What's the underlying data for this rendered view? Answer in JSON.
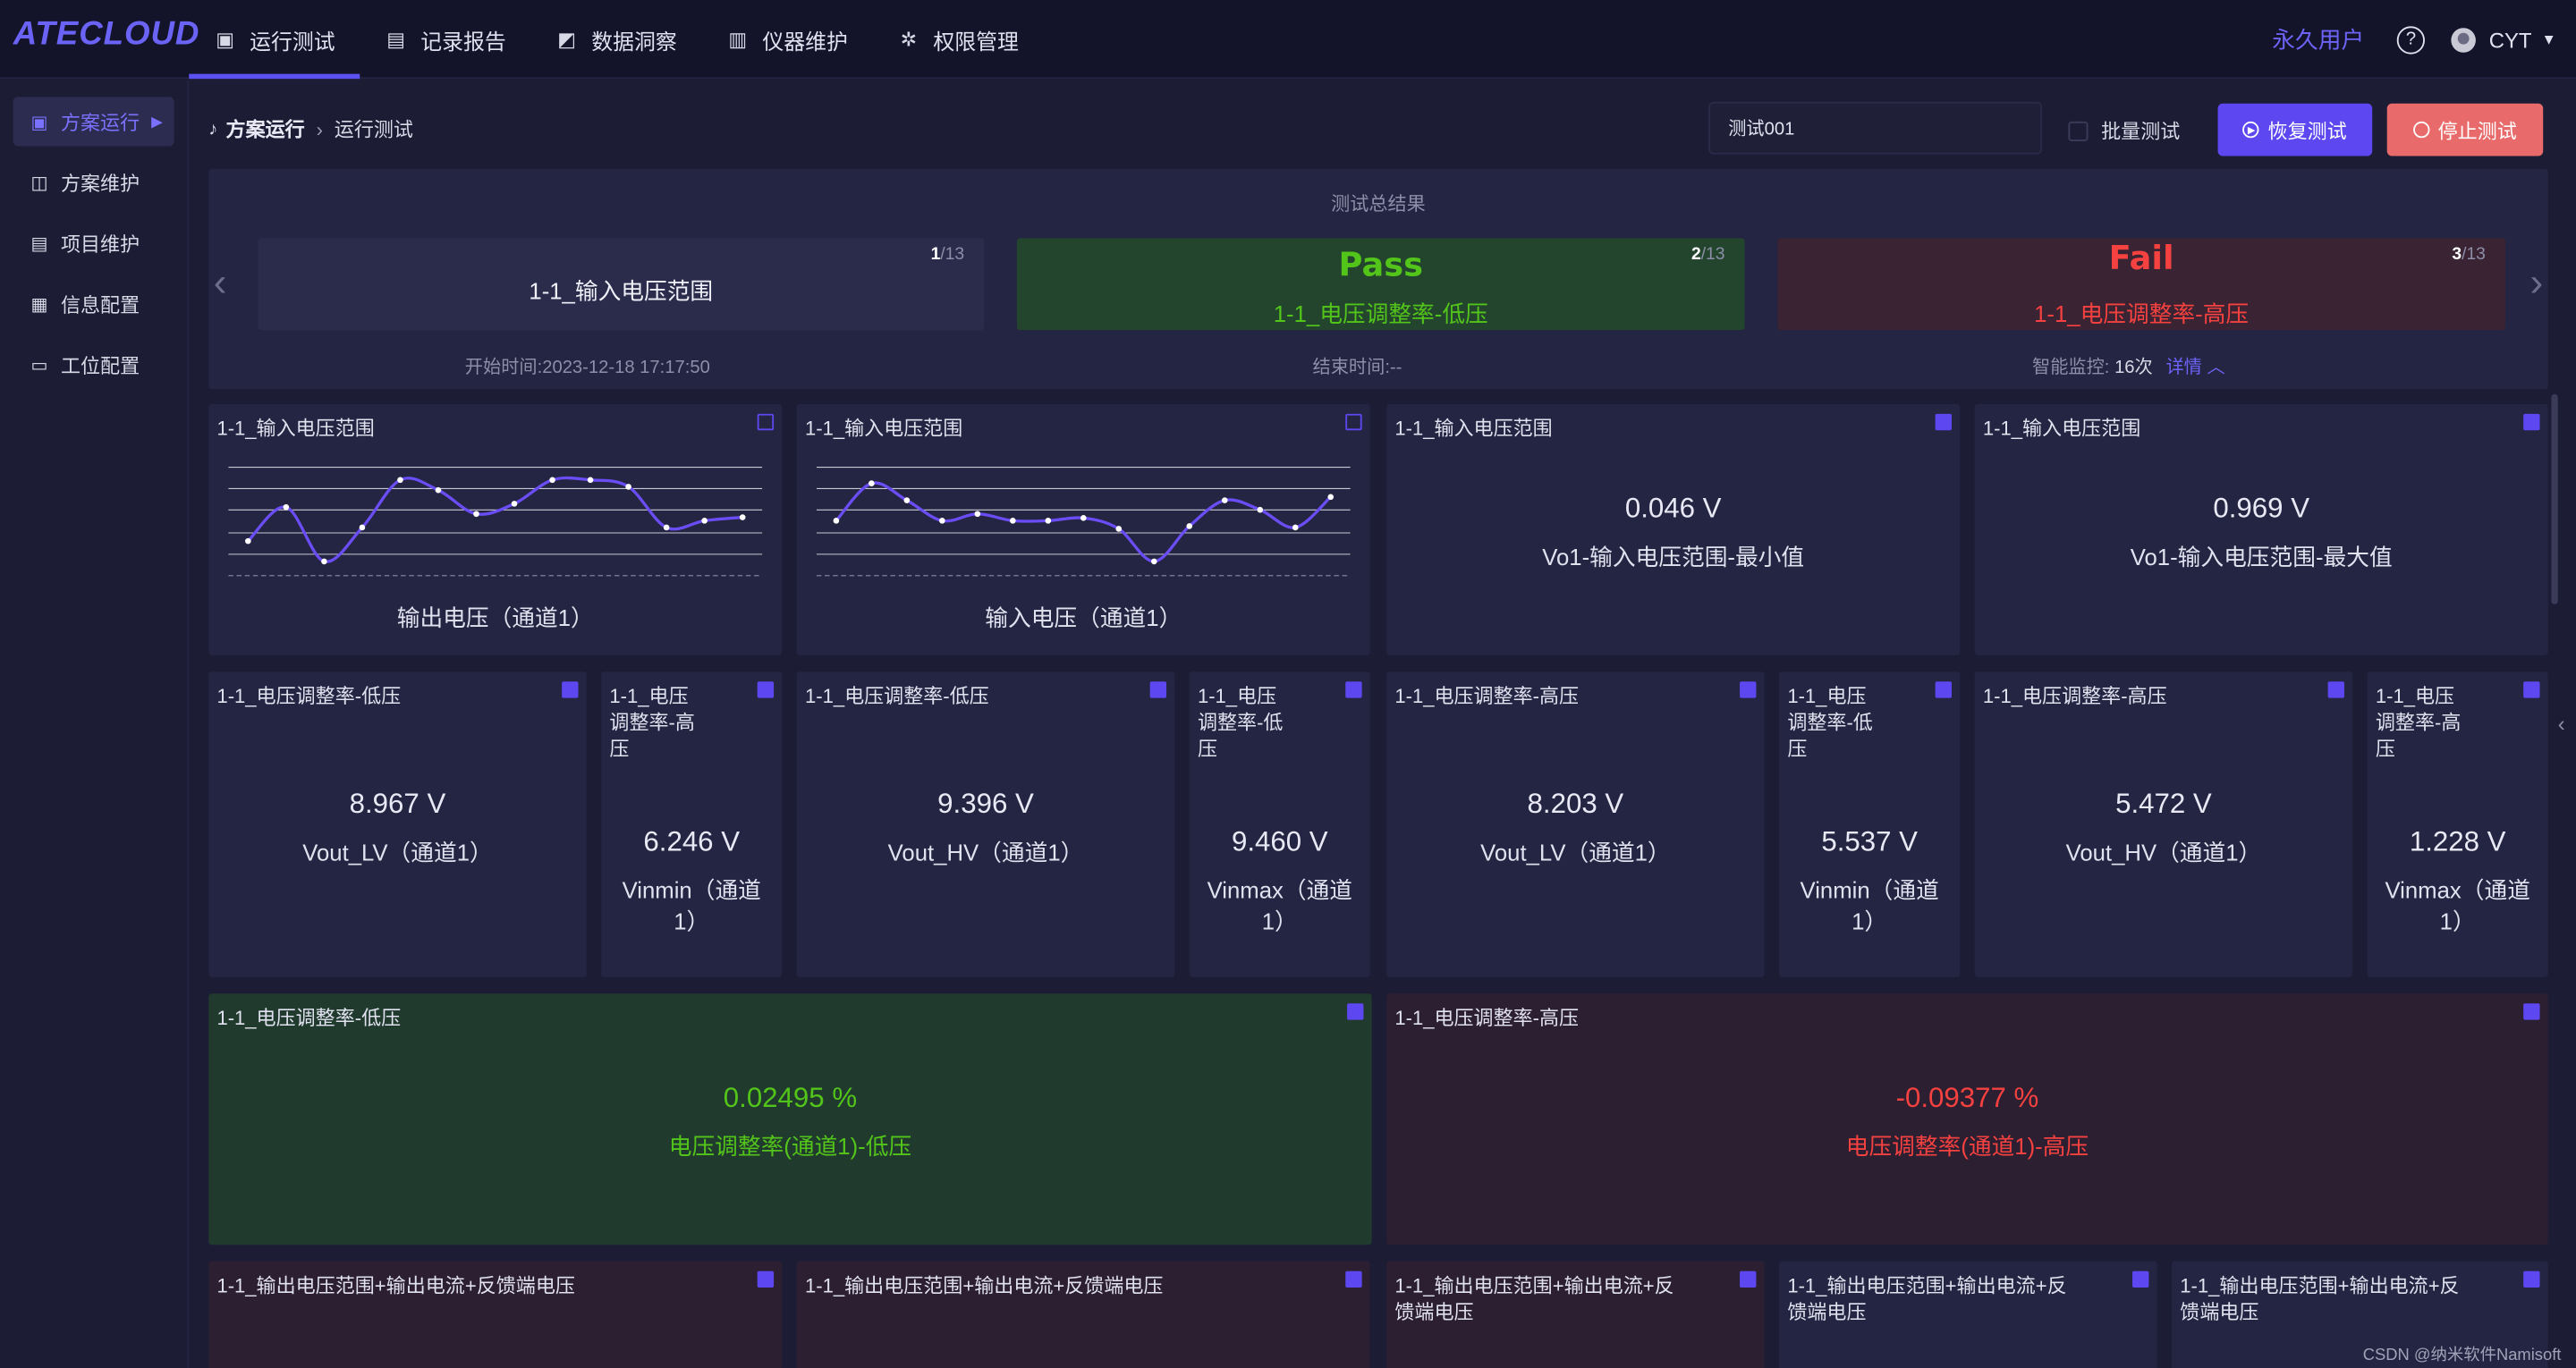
{
  "app": {
    "logo": "ATECLOUD"
  },
  "nav": {
    "items": [
      {
        "label": "运行测试",
        "icon": "chart-icon"
      },
      {
        "label": "记录报告",
        "icon": "report-icon"
      },
      {
        "label": "数据洞察",
        "icon": "insight-icon"
      },
      {
        "label": "仪器维护",
        "icon": "instrument-icon"
      },
      {
        "label": "权限管理",
        "icon": "permission-icon"
      }
    ],
    "active": "运行测试"
  },
  "user": {
    "license": "永久用户",
    "help": "?",
    "name": "CYT"
  },
  "sidebar": {
    "items": [
      {
        "label": "方案运行",
        "icon": "scheme-run-icon",
        "active": true
      },
      {
        "label": "方案维护",
        "icon": "scheme-maint-icon"
      },
      {
        "label": "项目维护",
        "icon": "project-icon"
      },
      {
        "label": "信息配置",
        "icon": "info-config-icon"
      },
      {
        "label": "工位配置",
        "icon": "station-icon"
      }
    ]
  },
  "breadcrumb": {
    "root": "方案运行",
    "current": "运行测试"
  },
  "toolbar": {
    "test_name": "测试001",
    "batch_label": "批量测试",
    "resume_label": "恢复测试",
    "stop_label": "停止测试"
  },
  "summary": {
    "title": "测试总结果",
    "cards": [
      {
        "page": "1",
        "total": "/13",
        "status": "",
        "label": "1-1_输入电压范围"
      },
      {
        "page": "2",
        "total": "/13",
        "status": "Pass",
        "label": "1-1_电压调整率-低压"
      },
      {
        "page": "3",
        "total": "/13",
        "status": "Fail",
        "label": "1-1_电压调整率-高压"
      }
    ],
    "start_label": "开始时间:",
    "start_value": "2023-12-18 17:17:50",
    "end_label": "结束时间:",
    "end_value": "--",
    "monitor_label": "智能监控:",
    "monitor_value": "16次",
    "detail_label": "详情 ︿"
  },
  "charts": [
    {
      "title": "1-1_输入电压范围",
      "caption": "输出电压（通道1）",
      "chart_data": {
        "type": "line",
        "values": [
          2,
          7,
          -1,
          4,
          11,
          9.5,
          6,
          7.5,
          11,
          11,
          10,
          4,
          5,
          5.5
        ]
      }
    },
    {
      "title": "1-1_输入电压范围",
      "caption": "输入电压（通道1）",
      "chart_data": {
        "type": "line",
        "values": [
          5,
          10.5,
          8,
          5,
          6,
          5,
          5,
          5.4,
          3.8,
          -1,
          4.2,
          8,
          6.6,
          4,
          8.5
        ]
      }
    }
  ],
  "row1_values": [
    {
      "title": "1-1_输入电压范围",
      "value": "0.046  V",
      "sub": "Vo1-输入电压范围-最小值"
    },
    {
      "title": "1-1_输入电压范围",
      "value": "0.969  V",
      "sub": "Vo1-输入电压范围-最大值"
    }
  ],
  "row2": [
    {
      "title": "1-1_电压调整率-低压",
      "value": "8.967  V",
      "sub": "Vout_LV（通道1）"
    },
    {
      "title": "1-1_电压\n调整率-高\n压",
      "value": "6.246  V",
      "sub": "Vinmin（通道\n1）"
    },
    {
      "title": "1-1_电压调整率-低压",
      "value": "9.396  V",
      "sub": "Vout_HV（通道1）"
    },
    {
      "title": "1-1_电压\n调整率-低\n压",
      "value": "9.460  V",
      "sub": "Vinmax（通道\n1）"
    },
    {
      "title": "1-1_电压调整率-高压",
      "value": "8.203  V",
      "sub": "Vout_LV（通道1）"
    },
    {
      "title": "1-1_电压\n调整率-低\n压",
      "value": "5.537  V",
      "sub": "Vinmin（通道\n1）"
    },
    {
      "title": "1-1_电压调整率-高压",
      "value": "5.472  V",
      "sub": "Vout_HV（通道1）"
    },
    {
      "title": "1-1_电压\n调整率-高\n压",
      "value": "1.228  V",
      "sub": "Vinmax（通道\n1）"
    }
  ],
  "row3": [
    {
      "title": "1-1_电压调整率-低压",
      "value": "0.02495  %",
      "sub": "电压调整率(通道1)-低压",
      "color": "#52c41a"
    },
    {
      "title": "1-1_电压调整率-高压",
      "value": "-0.09377  %",
      "sub": "电压调整率(通道1)-高压",
      "color": "#f5413f"
    }
  ],
  "row4": [
    {
      "title": "1-1_输出电压范围+输出电流+反馈端电压"
    },
    {
      "title": "1-1_输出电压范围+输出电流+反馈端电压"
    },
    {
      "title": "1-1_输出电压范围+输出电流+反\n馈端电压"
    },
    {
      "title": "1-1_输出电压范围+输出电流+反\n馈端电压"
    },
    {
      "title": "1-1_输出电压范围+输出电流+反\n馈端电压"
    }
  ],
  "colors": {
    "accent": "#5c47f0",
    "pass": "#52c41a",
    "fail": "#f5413f",
    "stop": "#e86a6a"
  },
  "watermark": "CSDN @纳米软件Namisoft"
}
